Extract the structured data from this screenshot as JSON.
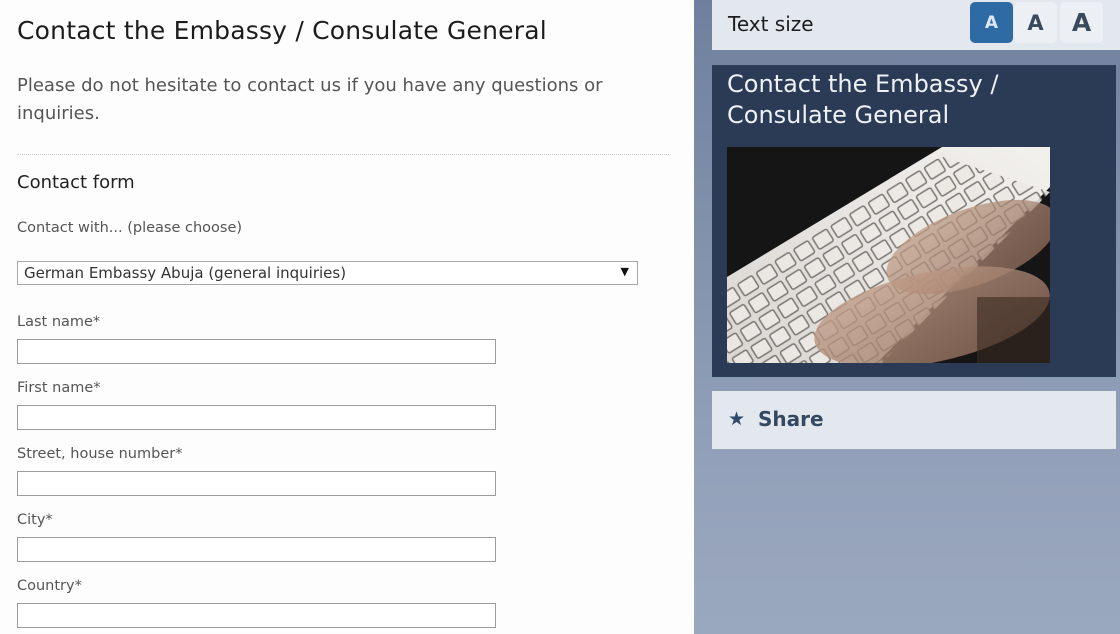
{
  "main": {
    "title": "Contact the Embassy / Consulate General",
    "intro": "Please do not hesitate to contact us if you have any questions or inquiries.",
    "form_heading": "Contact form",
    "contact_with": {
      "label": "Contact with... (please choose)",
      "selected": "German Embassy Abuja (general inquiries)",
      "arrow": "▼"
    },
    "fields": [
      {
        "label": "Last name*",
        "value": ""
      },
      {
        "label": "First name*",
        "value": ""
      },
      {
        "label": "Street, house number*",
        "value": ""
      },
      {
        "label": "City*",
        "value": ""
      },
      {
        "label": "Country*",
        "value": ""
      }
    ]
  },
  "sidebar": {
    "text_size": {
      "label": "Text size",
      "options": [
        {
          "glyph": "A",
          "size": "small",
          "selected": true
        },
        {
          "glyph": "A",
          "size": "medium",
          "selected": false
        },
        {
          "glyph": "A",
          "size": "large",
          "selected": false
        }
      ]
    },
    "teaser": {
      "title": "Contact the Embassy / Consulate General",
      "image_alt": "Hands typing on a white keyboard"
    },
    "share": {
      "icon": "star-icon",
      "label": "Share"
    }
  },
  "colors": {
    "accent": "#2e6aa3",
    "panel_dark": "#2b3a55",
    "sidebar_bg": "#8393ad",
    "bar_light": "#e3e7ee"
  }
}
